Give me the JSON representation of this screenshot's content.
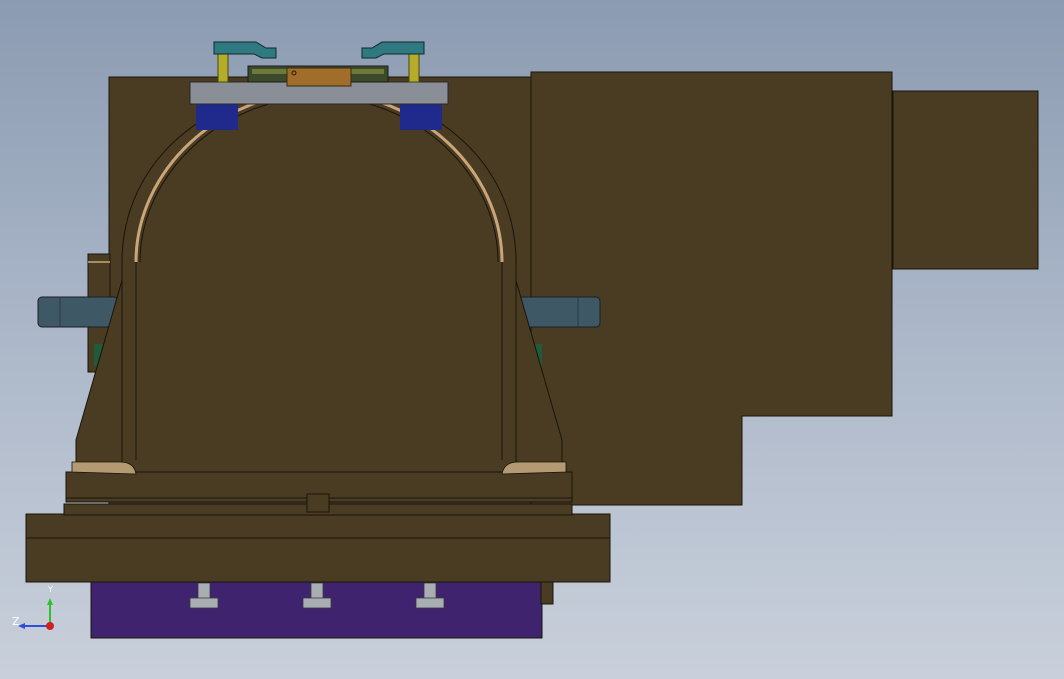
{
  "viewport": {
    "background_top": "#8b9bb1",
    "background_bottom": "#c9d0db"
  },
  "model": {
    "body_color": "#4a3b23",
    "edge_color": "#1a140a",
    "highlight_color": "#c9a67a",
    "base_block_color": "#3f236f",
    "clamp_color": "#2e7a80",
    "clamp_post_color": "#b5ad2a",
    "side_pin_color": "#3f5866",
    "plate_color": "#8a8f97",
    "blue_insert_color": "#1f2a8c"
  },
  "triad": {
    "x_label": "",
    "y_label": "Y",
    "z_label": "Z",
    "y_color": "#2fbf2f",
    "z_color": "#2f4fd8",
    "origin_color": "#d02020"
  }
}
